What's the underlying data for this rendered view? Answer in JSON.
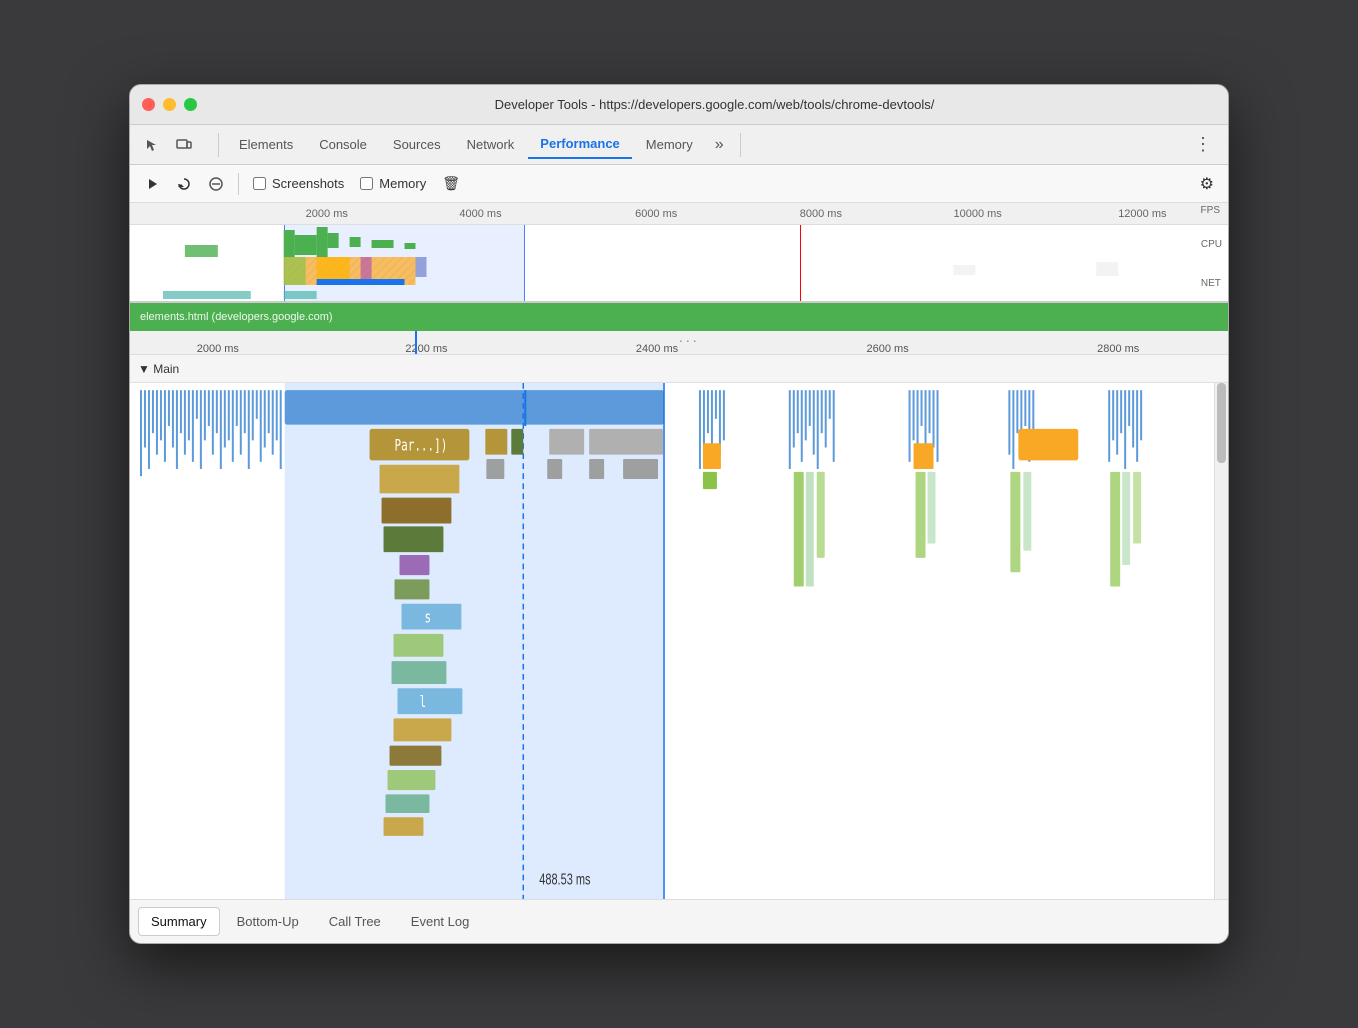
{
  "window": {
    "title": "Developer Tools - https://developers.google.com/web/tools/chrome-devtools/"
  },
  "tabs": {
    "items": [
      "Elements",
      "Console",
      "Sources",
      "Network",
      "Performance",
      "Memory"
    ],
    "active": "Performance",
    "more": "»",
    "kebab": "⋮"
  },
  "toolbar": {
    "record_label": "▶",
    "reload_label": "↺",
    "clear_label": "🚫",
    "screenshots_label": "Screenshots",
    "memory_label": "Memory",
    "trash_label": "🗑",
    "gear_label": "⚙"
  },
  "timeline": {
    "ruler_labels": [
      "2000 ms",
      "4000 ms",
      "6000 ms",
      "8000 ms",
      "10000 ms",
      "12000 ms"
    ],
    "fps_label": "FPS",
    "cpu_label": "CPU",
    "net_label": "NET"
  },
  "detail_ruler": {
    "labels": [
      "2000 ms",
      "2200 ms",
      "2400 ms",
      "2600 ms",
      "2800 ms"
    ],
    "dots": "..."
  },
  "flame": {
    "section_label": "▼ Main",
    "block_parse": "Par...])",
    "block_s": "s",
    "block_l": "l",
    "time_label": "488.53 ms"
  },
  "bottom_tabs": {
    "items": [
      "Summary",
      "Bottom-Up",
      "Call Tree",
      "Event Log"
    ],
    "active": "Summary"
  },
  "zone_bar": {
    "url": "elements.html (developers.google.com)"
  }
}
